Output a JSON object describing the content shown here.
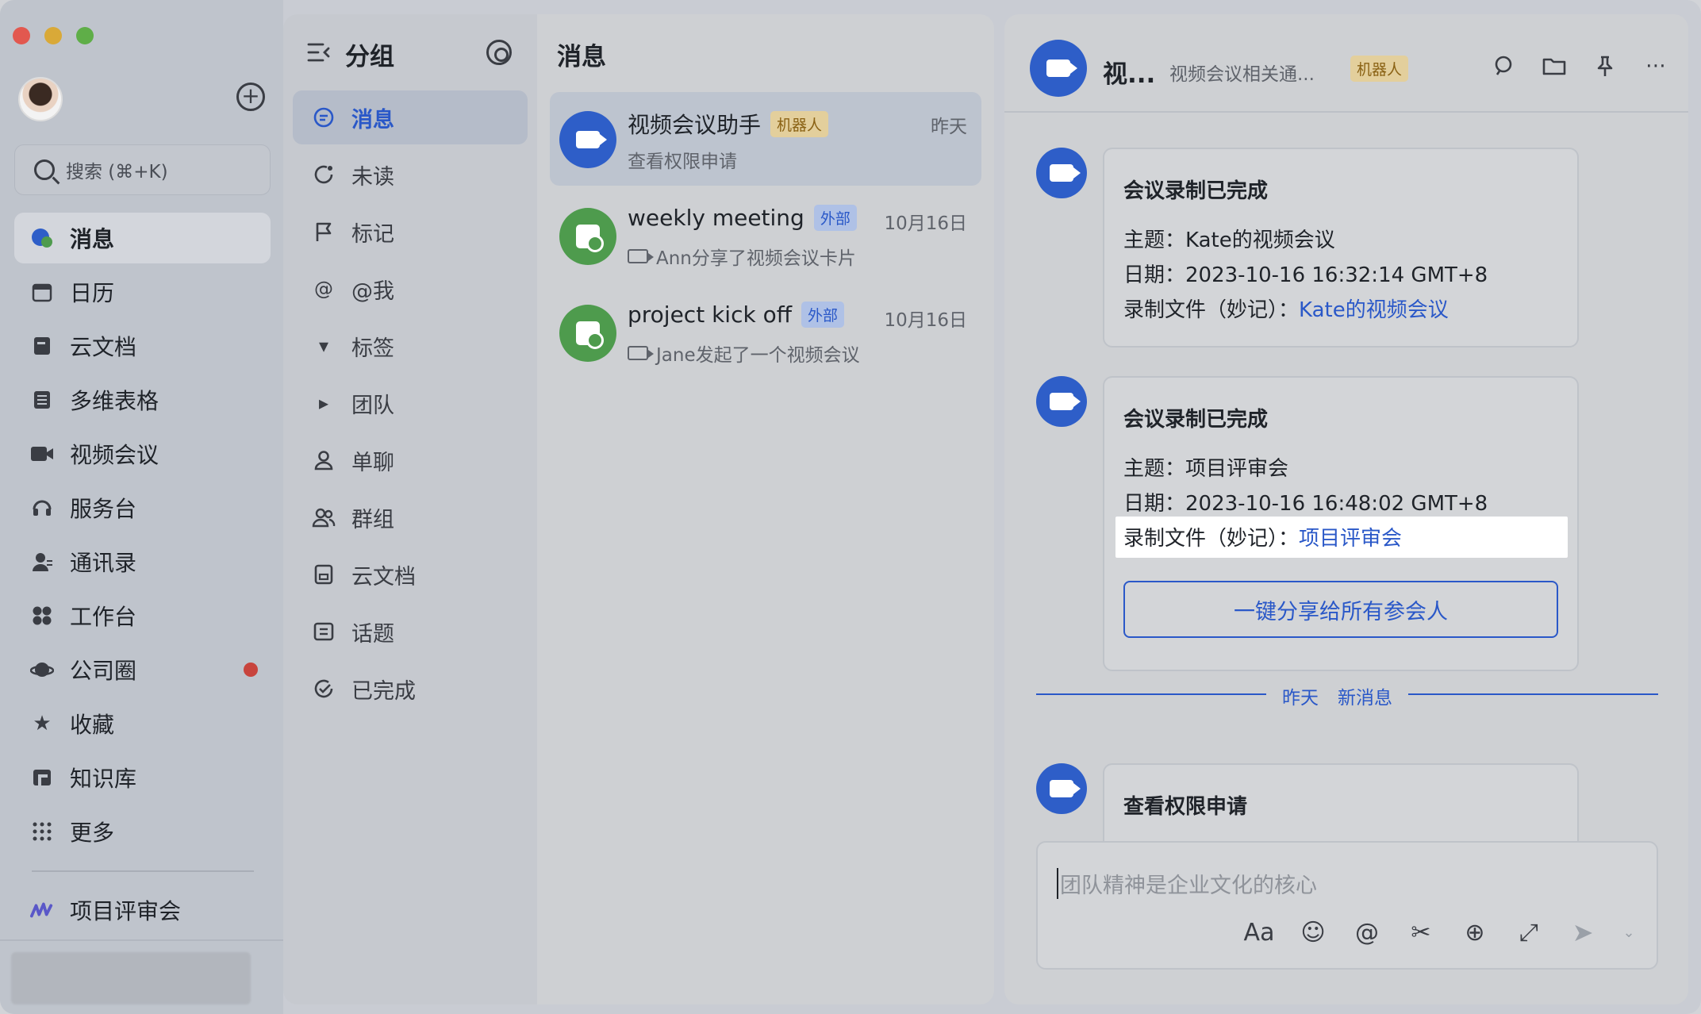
{
  "sidebar": {
    "search_placeholder": "搜索 (⌘+K)",
    "items": [
      {
        "label": "消息",
        "icon": "chat-bubble-icon",
        "active": true
      },
      {
        "label": "日历",
        "icon": "calendar-icon"
      },
      {
        "label": "云文档",
        "icon": "docs-icon"
      },
      {
        "label": "多维表格",
        "icon": "base-table-icon"
      },
      {
        "label": "视频会议",
        "icon": "video-camera-icon"
      },
      {
        "label": "服务台",
        "icon": "headset-icon"
      },
      {
        "label": "通讯录",
        "icon": "contacts-icon"
      },
      {
        "label": "工作台",
        "icon": "grid-apps-icon"
      },
      {
        "label": "公司圈",
        "icon": "planet-icon",
        "dot": true
      },
      {
        "label": "收藏",
        "icon": "star-icon"
      },
      {
        "label": "知识库",
        "icon": "wiki-icon"
      },
      {
        "label": "更多",
        "icon": "more-dots-icon"
      }
    ],
    "pinned": {
      "label": "项目评审会",
      "icon": "minutes-icon"
    }
  },
  "groups": {
    "title": "分组",
    "items": [
      {
        "label": "消息",
        "icon": "chat-icon",
        "active": true
      },
      {
        "label": "未读",
        "icon": "unread-icon"
      },
      {
        "label": "标记",
        "icon": "flag-icon"
      },
      {
        "label": "@我",
        "icon": "at-icon"
      },
      {
        "label": "标签",
        "icon": "caret-down-icon"
      },
      {
        "label": "团队",
        "icon": "caret-right-icon"
      },
      {
        "label": "单聊",
        "icon": "person-icon"
      },
      {
        "label": "群组",
        "icon": "group-icon"
      },
      {
        "label": "云文档",
        "icon": "doc-icon"
      },
      {
        "label": "话题",
        "icon": "topic-icon"
      },
      {
        "label": "已完成",
        "icon": "done-check-icon"
      }
    ]
  },
  "message_list": {
    "title": "消息",
    "chats": [
      {
        "name": "视频会议助手",
        "badge": "机器人",
        "time": "昨天",
        "preview": "查看权限申请"
      },
      {
        "name": "weekly meeting",
        "badge": "外部",
        "time": "10月16日",
        "preview": "Ann分享了视频会议卡片"
      },
      {
        "name": "project kick off",
        "badge": "外部",
        "time": "10月16日",
        "preview": "Jane发起了一个视频会议"
      }
    ]
  },
  "chat": {
    "header": {
      "name": "视...",
      "desc": "视频会议相关通...",
      "badge": "机器人"
    },
    "cards": [
      {
        "title": "会议录制已完成",
        "topic_label": "主题：",
        "topic": "Kate的视频会议",
        "date_label": "日期：",
        "date": "2023-10-16 16:32:14 GMT+8",
        "file_label": "录制文件（妙记）：",
        "file": "Kate的视频会议"
      },
      {
        "title": "会议录制已完成",
        "topic_label": "主题：",
        "topic": "项目评审会",
        "date_label": "日期：",
        "date": "2023-10-16 16:48:02 GMT+8",
        "file_label": "录制文件（妙记）：",
        "file": "项目评审会",
        "button": "一键分享给所有参会人"
      },
      {
        "title": "查看权限申请"
      }
    ],
    "divider": {
      "day": "昨天",
      "label": "新消息"
    },
    "composer": {
      "placeholder": "团队精神是企业文化的核心"
    }
  }
}
